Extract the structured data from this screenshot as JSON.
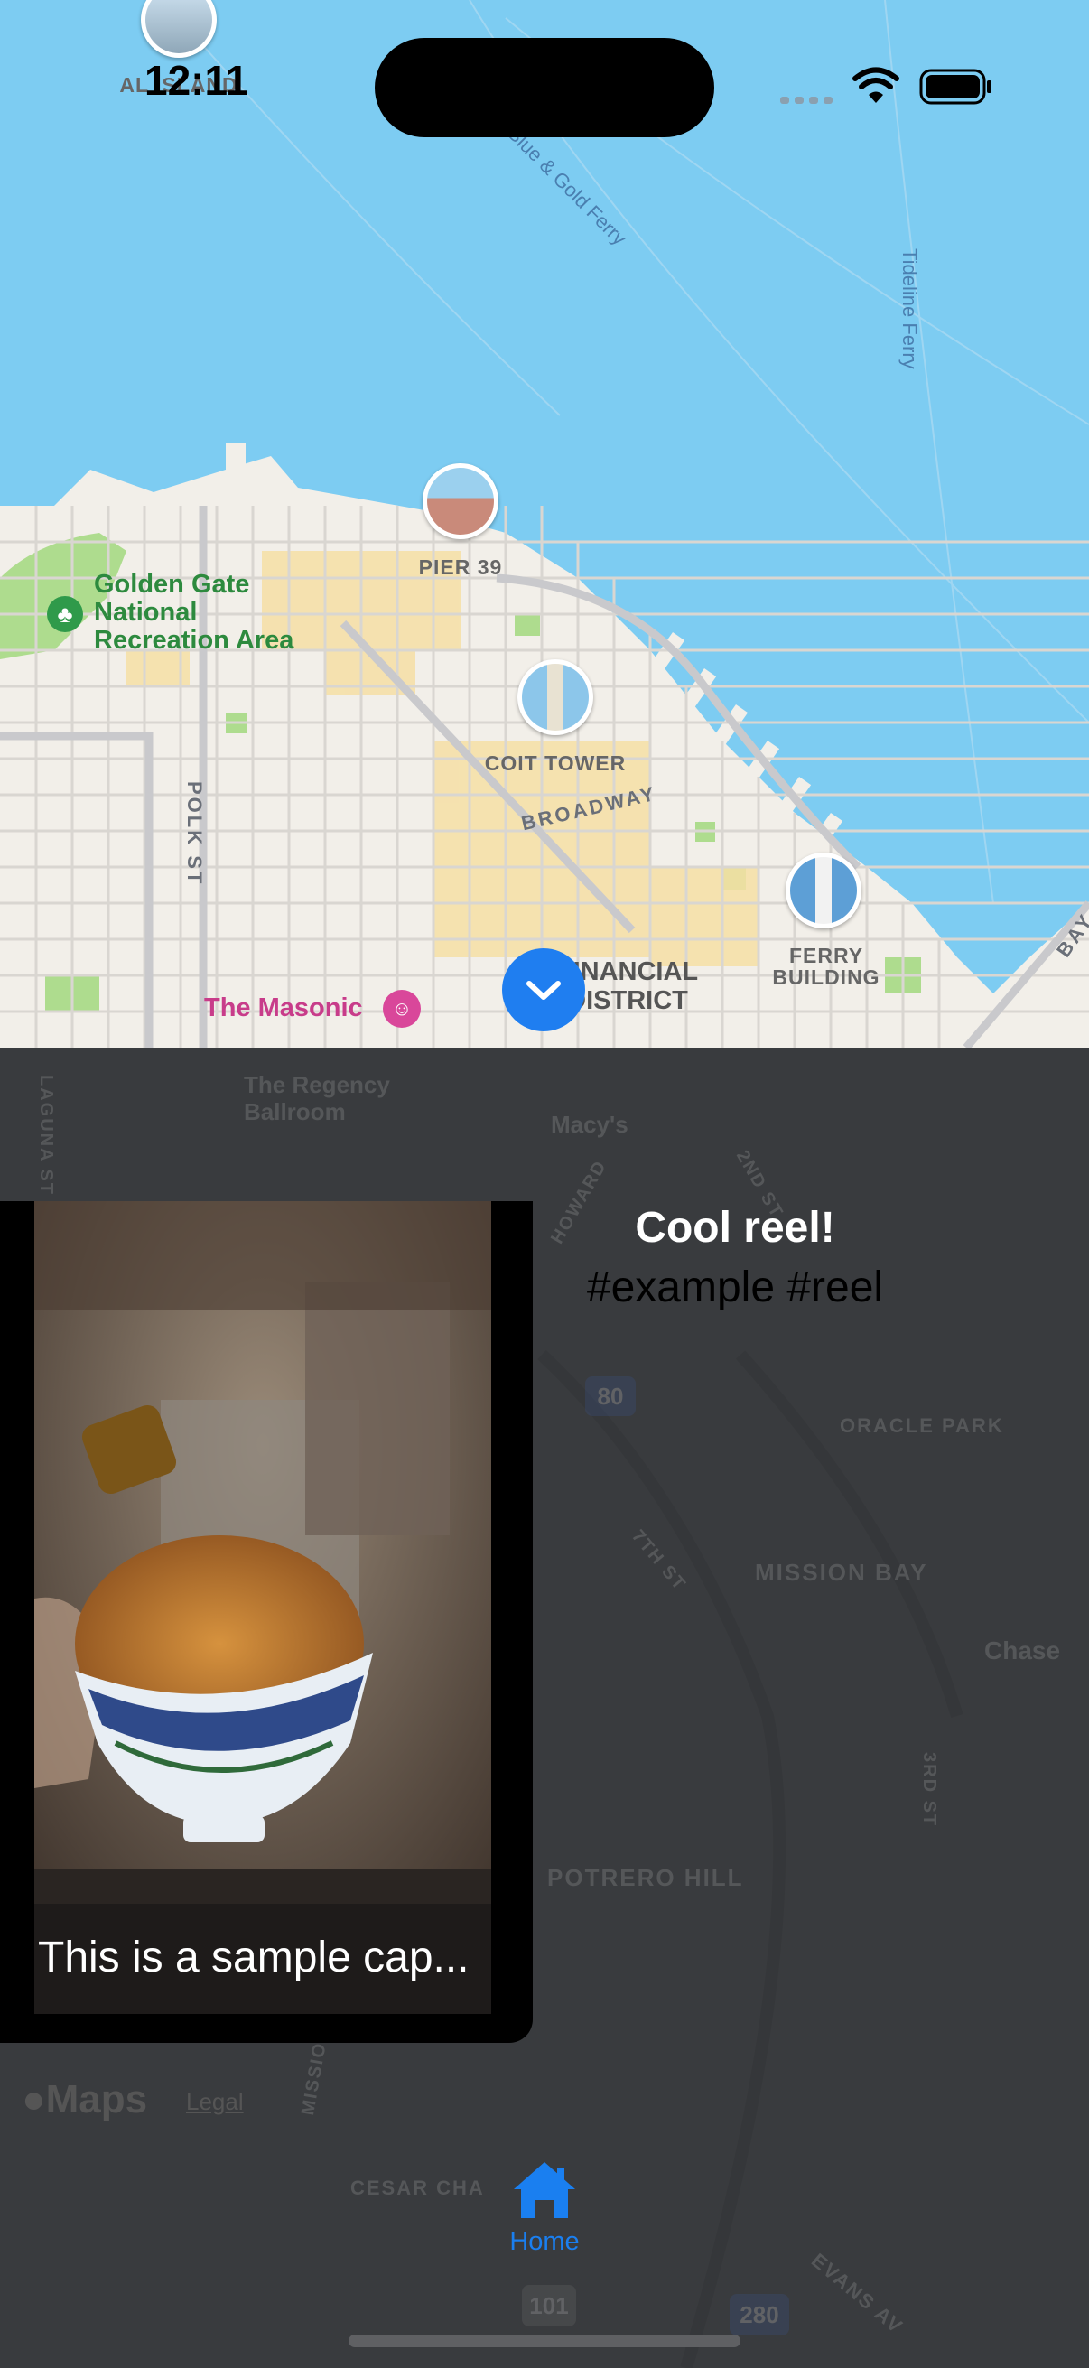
{
  "status_bar": {
    "time": "12:11"
  },
  "map": {
    "places": {
      "alcatraz": "ALCATRAZ ISLAND",
      "alcatraz_visible": "AL         ISLAND",
      "pier39": "PIER 39",
      "coit": "COIT TOWER",
      "ferry": "FERRY BUILDING",
      "golden_gate": "Golden Gate National Recreation Area",
      "masonic": "The Masonic",
      "financial": "FINANCIAL DISTRICT"
    },
    "streets": {
      "polk": "POLK ST",
      "broadway": "BROADWAY",
      "ferry_route": "Blue & Gold Ferry",
      "tideline": "Tideline Ferry",
      "bay": "BAY"
    },
    "dimmed": {
      "regency": "The Regency Ballroom",
      "macys": "Macy's",
      "oracle": "ORACLE PARK",
      "mission_bay": "MISSION BAY",
      "chase": "Chase",
      "potrero": "POTRERO HILL",
      "laguna": "LAGUNA ST",
      "howard": "HOWARD",
      "second": "2ND ST",
      "seventh": "7TH ST",
      "third": "3RD ST",
      "mission": "MISSION ST",
      "cesar": "CESAR CHA",
      "evans": "EVANS AV",
      "i80": "80",
      "us101": "101",
      "i280": "280"
    },
    "colors": {
      "water": "#7dccf2",
      "land": "#f3f1ee",
      "park": "#aedc8e",
      "accent": "#1f7ef0"
    }
  },
  "reel": {
    "title": "Cool reel!",
    "tags": "#example #reel",
    "caption": "This is a sample cap..."
  },
  "attribution": {
    "maps": "Maps",
    "legal": "Legal"
  },
  "tab_bar": {
    "home_label": "Home"
  }
}
